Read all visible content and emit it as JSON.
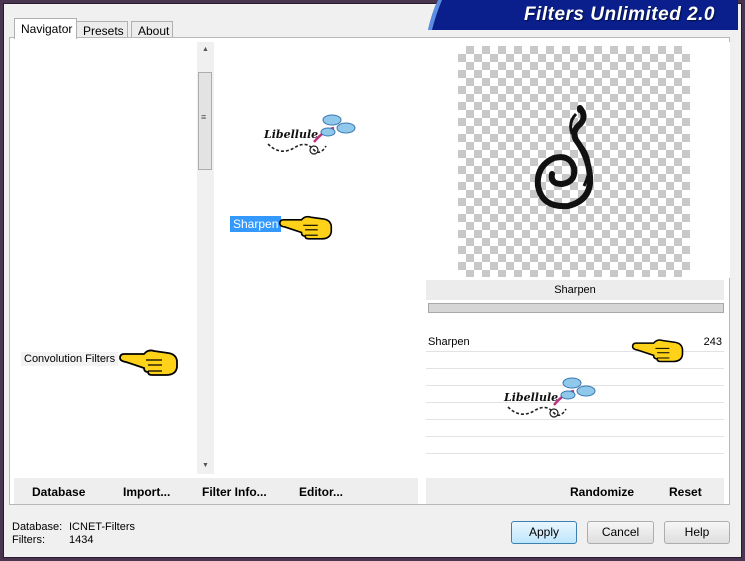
{
  "window": {
    "title": "Filters Unlimited 2.0"
  },
  "tabs": [
    {
      "label": "Navigator"
    },
    {
      "label": "Presets"
    },
    {
      "label": "About"
    }
  ],
  "categories": {
    "selected": "Convolution Filters"
  },
  "filters": {
    "selected": "Sharpen"
  },
  "watermark": {
    "text": "Libellule"
  },
  "left_buttons": {
    "database": "Database",
    "import": "Import...",
    "filter_info": "Filter Info...",
    "editor": "Editor..."
  },
  "right_buttons": {
    "randomize": "Randomize",
    "reset": "Reset"
  },
  "preview": {
    "filter_name": "Sharpen"
  },
  "parameters": [
    {
      "name": "Sharpen",
      "value": "243"
    }
  ],
  "status": {
    "database_label": "Database:",
    "database_value": "ICNET-Filters",
    "filters_label": "Filters:",
    "filters_value": "1434"
  },
  "dialog_buttons": {
    "apply": "Apply",
    "cancel": "Cancel",
    "help": "Help"
  }
}
